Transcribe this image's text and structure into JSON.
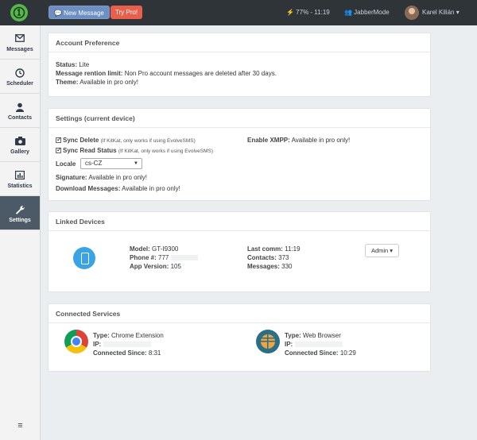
{
  "topbar": {
    "new_message": "💬 New Message",
    "try_pro": "Try Pro!",
    "battery": "⚡ 77% - 11:19",
    "mode": "👥 JabberMode",
    "user": "Karel Kilián ▾"
  },
  "sidebar": {
    "items": [
      {
        "label": "Messages",
        "icon": "envelope-icon"
      },
      {
        "label": "Scheduler",
        "icon": "clock-icon"
      },
      {
        "label": "Contacts",
        "icon": "user-icon"
      },
      {
        "label": "Gallery",
        "icon": "camera-icon"
      },
      {
        "label": "Statistics",
        "icon": "chart-icon"
      },
      {
        "label": "Settings",
        "icon": "wrench-icon"
      }
    ],
    "menu": "≡"
  },
  "account": {
    "title": "Account Preference",
    "status_label": "Status:",
    "status_value": "Lite",
    "retention_label": "Message rention limit:",
    "retention_value": "Non Pro account messages are deleted after 30 days.",
    "theme_label": "Theme:",
    "theme_value": "Available in pro only!"
  },
  "settings": {
    "title": "Settings (current device)",
    "sync_delete_label": "Sync Delete",
    "sync_delete_note": "(If KitKat, only works if using EvolveSMS)",
    "sync_read_label": "Sync Read Status",
    "sync_read_note": "(If KitKat, only works if using EvolveSMS)",
    "locale_label": "Locale",
    "locale_value": "cs-CZ",
    "signature_label": "Signature:",
    "signature_value": "Available in pro only!",
    "download_label": "Download Messages:",
    "download_value": "Available in pro only!",
    "xmpp_label": "Enable XMPP:",
    "xmpp_value": "Available in pro only!"
  },
  "devices": {
    "title": "Linked Devices",
    "model_label": "Model:",
    "model_value": "GT-I9300",
    "phone_label": "Phone #:",
    "phone_value": "777",
    "app_label": "App Version:",
    "app_value": "105",
    "last_label": "Last comm:",
    "last_value": "11:19",
    "contacts_label": "Contacts:",
    "contacts_value": "373",
    "messages_label": "Messages:",
    "messages_value": "330",
    "admin": "Admin ▾"
  },
  "services": {
    "title": "Connected Services",
    "s1_type_label": "Type:",
    "s1_type_value": "Chrome Extension",
    "s1_ip_label": "IP:",
    "s1_since_label": "Connected Since:",
    "s1_since_value": "8:31",
    "s2_type_label": "Type:",
    "s2_type_value": "Web Browser",
    "s2_ip_label": "IP:",
    "s2_since_label": "Connected Since:",
    "s2_since_value": "10:29"
  }
}
